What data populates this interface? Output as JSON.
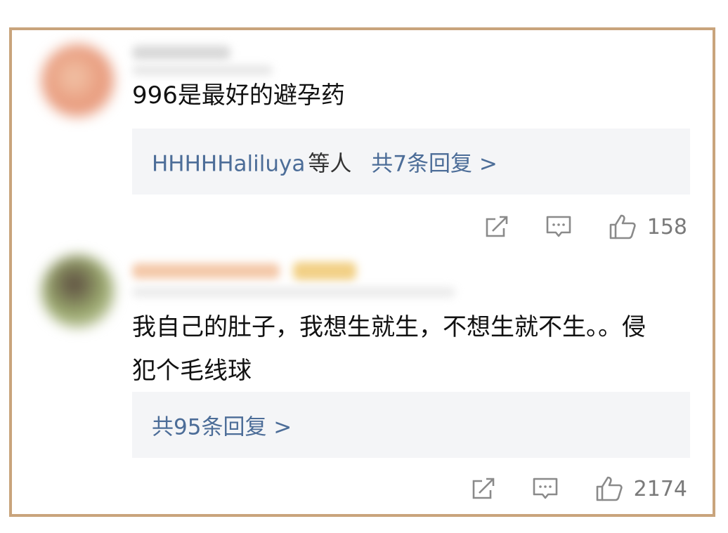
{
  "comments": [
    {
      "text": "996是最好的避孕药",
      "reply_name": "HHHHHaliluya",
      "reply_name_suffix": "等人",
      "reply_count_label": "共7条回复 >",
      "likes": "158"
    },
    {
      "text": "我自己的肚子，我想生就生，不想生就不生。。侵犯个毛线球",
      "reply_count_label": "共95条回复 >",
      "likes": "2174"
    }
  ],
  "icons": {
    "share": "share-icon",
    "comment": "comment-icon",
    "like": "thumbs-up-icon"
  },
  "colors": {
    "frame": "#c9a47c",
    "link": "#4c6d98",
    "reply_bg": "#f4f5f7",
    "meta": "#7a7a7a"
  }
}
